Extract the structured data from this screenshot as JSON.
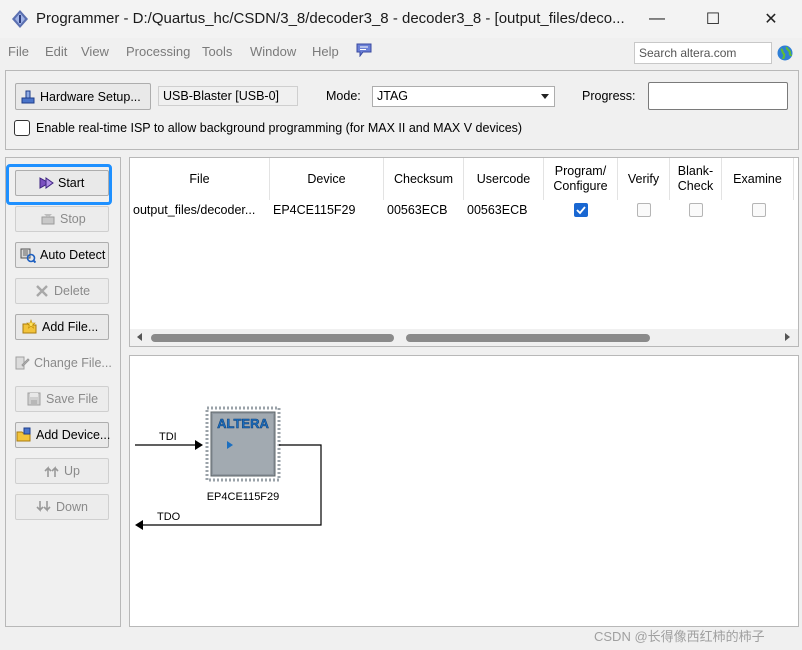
{
  "window": {
    "title": "Programmer - D:/Quartus_hc/CSDN/3_8/decoder3_8 - decoder3_8 - [output_files/deco...",
    "controls": [
      "—",
      "☐",
      "✕"
    ]
  },
  "menu": {
    "items": [
      "File",
      "Edit",
      "View",
      "Processing",
      "Tools",
      "Window",
      "Help"
    ],
    "search_placeholder": "Search altera.com"
  },
  "toolbar": {
    "hardware_setup_label": "Hardware Setup...",
    "hardware_value": "USB-Blaster [USB-0]",
    "mode_label": "Mode:",
    "mode_value": "JTAG",
    "progress_label": "Progress:",
    "progress_percent": 0,
    "isp_label": "Enable real-time ISP to allow background programming (for MAX II and MAX V devices)",
    "isp_checked": false
  },
  "sidebar": {
    "buttons": [
      {
        "label": "Start",
        "enabled": true,
        "icon": "start-icon"
      },
      {
        "label": "Stop",
        "enabled": false,
        "icon": "stop-icon"
      },
      {
        "label": "Auto Detect",
        "enabled": true,
        "icon": "auto-detect-icon"
      },
      {
        "label": "Delete",
        "enabled": false,
        "icon": "delete-icon"
      },
      {
        "label": "Add File...",
        "enabled": true,
        "icon": "add-file-icon"
      },
      {
        "label": "Change File...",
        "enabled": false,
        "icon": "change-file-icon"
      },
      {
        "label": "Save File",
        "enabled": false,
        "icon": "save-file-icon"
      },
      {
        "label": "Add Device...",
        "enabled": true,
        "icon": "add-device-icon"
      },
      {
        "label": "Up",
        "enabled": false,
        "icon": "up-icon"
      },
      {
        "label": "Down",
        "enabled": false,
        "icon": "down-icon"
      }
    ]
  },
  "table": {
    "headers": [
      "File",
      "Device",
      "Checksum",
      "Usercode",
      "Program/\nConfigure",
      "Verify",
      "Blank-\nCheck",
      "Examine"
    ],
    "rows": [
      {
        "file": "output_files/decoder...",
        "device": "EP4CE115F29",
        "checksum": "00563ECB",
        "usercode": "00563ECB",
        "program": true,
        "verify": false,
        "blank_check": false,
        "examine": false
      }
    ]
  },
  "chain": {
    "tdi_label": "TDI",
    "tdo_label": "TDO",
    "chip_logo": "ALTERA",
    "device_label": "EP4CE115F29"
  },
  "watermark": "CSDN @长得像西红柿的柿子",
  "colors": {
    "highlight": "#1e90ff",
    "checkbox_on": "#1967d2",
    "chip_body": "#8f979f",
    "logo": "#1c6fc0"
  }
}
